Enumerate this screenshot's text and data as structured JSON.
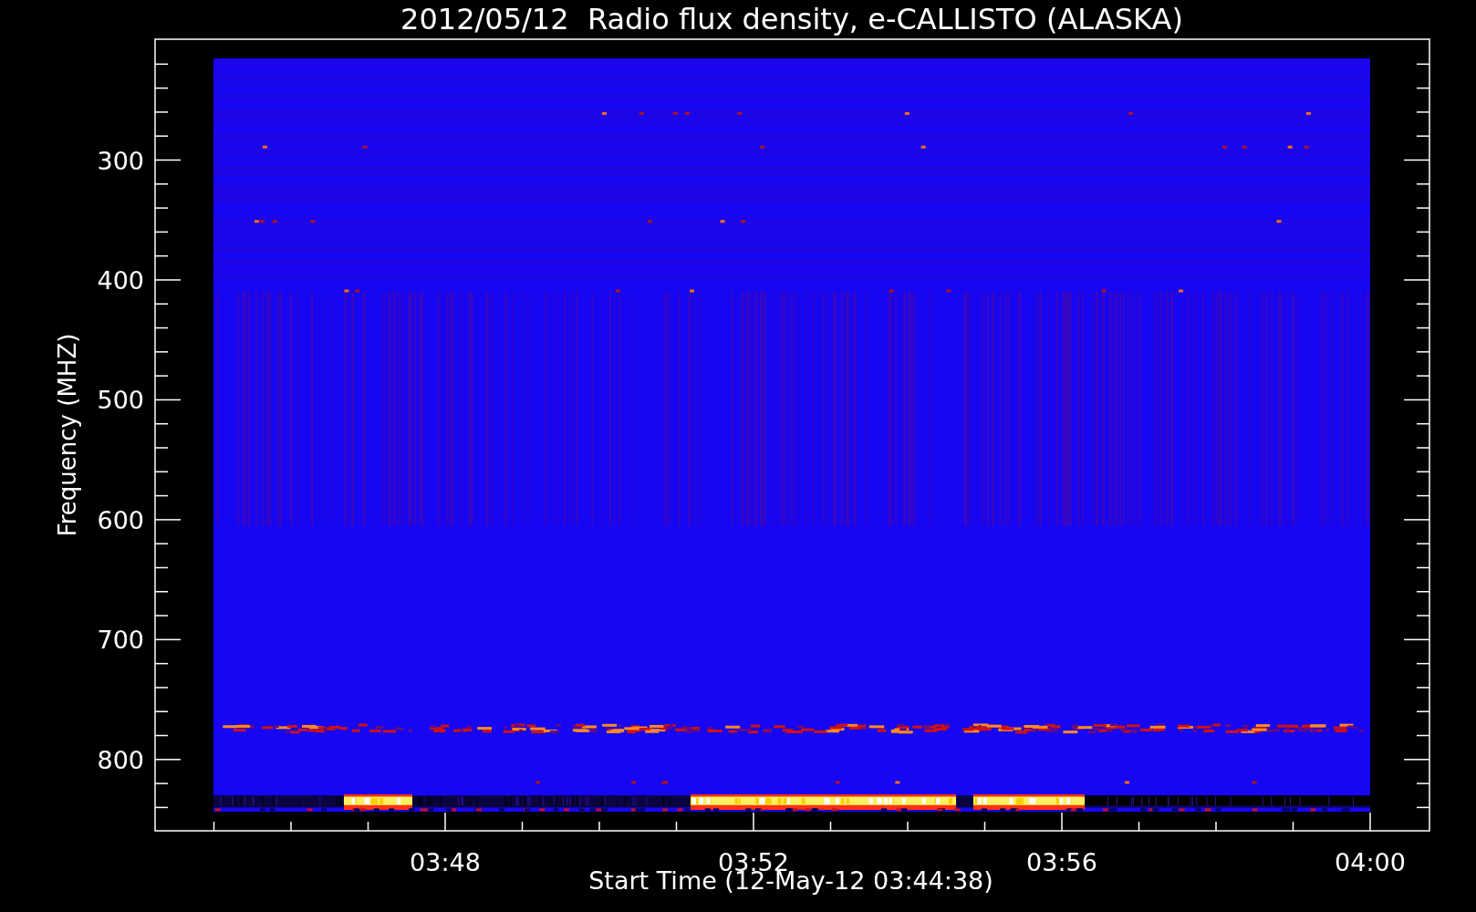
{
  "title": "2012/05/12  Radio flux density, e-CALLISTO (ALASKA)",
  "y_axis": {
    "label": "Frequency (MHZ)",
    "ticks": [
      "300",
      "400",
      "500",
      "600",
      "700",
      "800"
    ]
  },
  "x_axis": {
    "label": "Start Time (12-May-12 03:44:38)",
    "ticks": [
      "03:48",
      "03:52",
      "03:56",
      "04:00"
    ]
  }
}
